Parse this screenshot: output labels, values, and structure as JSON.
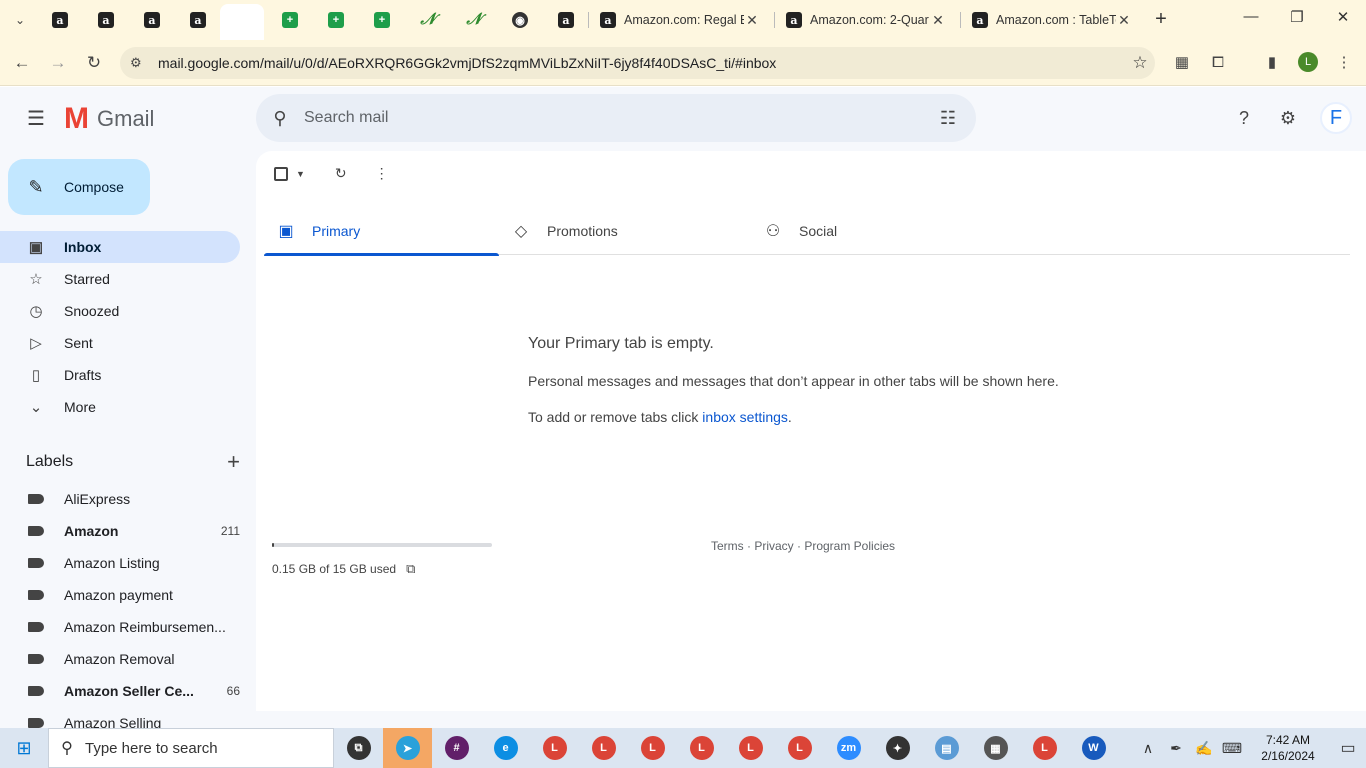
{
  "browser": {
    "pinned_tabs": [
      {
        "icon": "amazon-icon",
        "glyph": "a",
        "kind": "amz"
      },
      {
        "icon": "amazon-icon",
        "glyph": "a",
        "kind": "amz"
      },
      {
        "icon": "amazon-icon",
        "glyph": "a",
        "kind": "amz"
      },
      {
        "icon": "amazon-icon",
        "glyph": "a",
        "kind": "amz"
      },
      {
        "icon": "gmail-icon",
        "glyph": "M",
        "kind": "gmail"
      },
      {
        "icon": "sheets-icon",
        "glyph": "+",
        "kind": "sheet"
      },
      {
        "icon": "sheets-icon",
        "glyph": "+",
        "kind": "sheet"
      },
      {
        "icon": "sheets-icon",
        "glyph": "+",
        "kind": "sheet"
      },
      {
        "icon": "green-logo-icon",
        "glyph": "𝒩",
        "kind": "green"
      },
      {
        "icon": "green-logo-icon",
        "glyph": "𝒩",
        "kind": "green"
      },
      {
        "icon": "globe-icon",
        "glyph": "◉",
        "kind": "dark"
      },
      {
        "icon": "amazon-icon",
        "glyph": "a",
        "kind": "amz"
      }
    ],
    "tabs": [
      {
        "title": "Amazon.com: Regal B",
        "close": "✕"
      },
      {
        "title": "Amazon.com: 2-Quar",
        "close": "✕"
      },
      {
        "title": "Amazon.com : TableTo",
        "close": "✕"
      }
    ],
    "new_tab": "+",
    "window_controls": {
      "minimize": "—",
      "restore": "❐",
      "close": "✕"
    },
    "url": "mail.google.com/mail/u/0/d/AEoRXRQR6GGk2vmjDfS2zqmMViLbZxNiIT-6jy8f4f40DSAsC_ti/#inbox",
    "profile_initial": "L"
  },
  "gmail": {
    "product_name": "Gmail",
    "search_placeholder": "Search mail",
    "account_initial": "F",
    "compose_label": "Compose",
    "nav": [
      {
        "name": "inbox",
        "label": "Inbox",
        "icon": "▣",
        "active": true
      },
      {
        "name": "starred",
        "label": "Starred",
        "icon": "☆",
        "active": false
      },
      {
        "name": "snoozed",
        "label": "Snoozed",
        "icon": "◷",
        "active": false
      },
      {
        "name": "sent",
        "label": "Sent",
        "icon": "▷",
        "active": false
      },
      {
        "name": "drafts",
        "label": "Drafts",
        "icon": "▯",
        "active": false
      },
      {
        "name": "more",
        "label": "More",
        "icon": "⌄",
        "active": false
      }
    ],
    "labels_title": "Labels",
    "labels": [
      {
        "name": "AliExpress",
        "count": "",
        "bold": false
      },
      {
        "name": "Amazon",
        "count": "211",
        "bold": true
      },
      {
        "name": "Amazon Listing",
        "count": "",
        "bold": false
      },
      {
        "name": "Amazon payment",
        "count": "",
        "bold": false
      },
      {
        "name": "Amazon Reimbursemen...",
        "count": "",
        "bold": false
      },
      {
        "name": "Amazon Removal",
        "count": "",
        "bold": false
      },
      {
        "name": "Amazon Seller Ce...",
        "count": "66",
        "bold": true
      },
      {
        "name": "Amazon Selling",
        "count": "",
        "bold": false
      }
    ],
    "category_tabs": [
      {
        "label": "Primary",
        "icon": "▣",
        "active": true
      },
      {
        "label": "Promotions",
        "icon": "◇",
        "active": false
      },
      {
        "label": "Social",
        "icon": "⚇",
        "active": false
      }
    ],
    "empty_title": "Your Primary tab is empty.",
    "empty_line1": "Personal messages and messages that don’t appear in other tabs will be shown here.",
    "empty_line2_prefix": "To add or remove tabs click ",
    "empty_line2_link": "inbox settings",
    "empty_line2_suffix": ".",
    "storage_text": "0.15 GB of 15 GB used",
    "storage_fraction": 0.01,
    "footer": "Terms · Privacy · Program Policies"
  },
  "taskbar": {
    "search_placeholder": "Type here to search",
    "apps": [
      {
        "icon": "task-view-icon",
        "glyph": "⧉",
        "color": "#333333",
        "active": false
      },
      {
        "icon": "telegram-icon",
        "glyph": "➤",
        "color": "#2aa1da",
        "active": true
      },
      {
        "icon": "slack-icon",
        "glyph": "#",
        "color": "#611f69",
        "active": false
      },
      {
        "icon": "edge-icon",
        "glyph": "e",
        "color": "#0c8ee3",
        "active": false
      },
      {
        "icon": "chrome-icon",
        "glyph": "L",
        "color": "#db4437",
        "active": false
      },
      {
        "icon": "chrome-icon",
        "glyph": "L",
        "color": "#db4437",
        "active": false
      },
      {
        "icon": "chrome-icon",
        "glyph": "L",
        "color": "#db4437",
        "active": false
      },
      {
        "icon": "chrome-icon",
        "glyph": "L",
        "color": "#db4437",
        "active": false
      },
      {
        "icon": "chrome-icon",
        "glyph": "L",
        "color": "#db4437",
        "active": false
      },
      {
        "icon": "chrome-icon",
        "glyph": "L",
        "color": "#db4437",
        "active": false
      },
      {
        "icon": "zoom-icon",
        "glyph": "zm",
        "color": "#2d8cff",
        "active": false
      },
      {
        "icon": "app-icon",
        "glyph": "✦",
        "color": "#333333",
        "active": false
      },
      {
        "icon": "notepad-icon",
        "glyph": "▤",
        "color": "#5b9bd5",
        "active": false
      },
      {
        "icon": "calculator-icon",
        "glyph": "▦",
        "color": "#555555",
        "active": false
      },
      {
        "icon": "chrome-icon",
        "glyph": "L",
        "color": "#db4437",
        "active": false
      },
      {
        "icon": "word-icon",
        "glyph": "W",
        "color": "#185abd",
        "active": false
      }
    ],
    "time": "7:42 AM",
    "date": "2/16/2024"
  }
}
